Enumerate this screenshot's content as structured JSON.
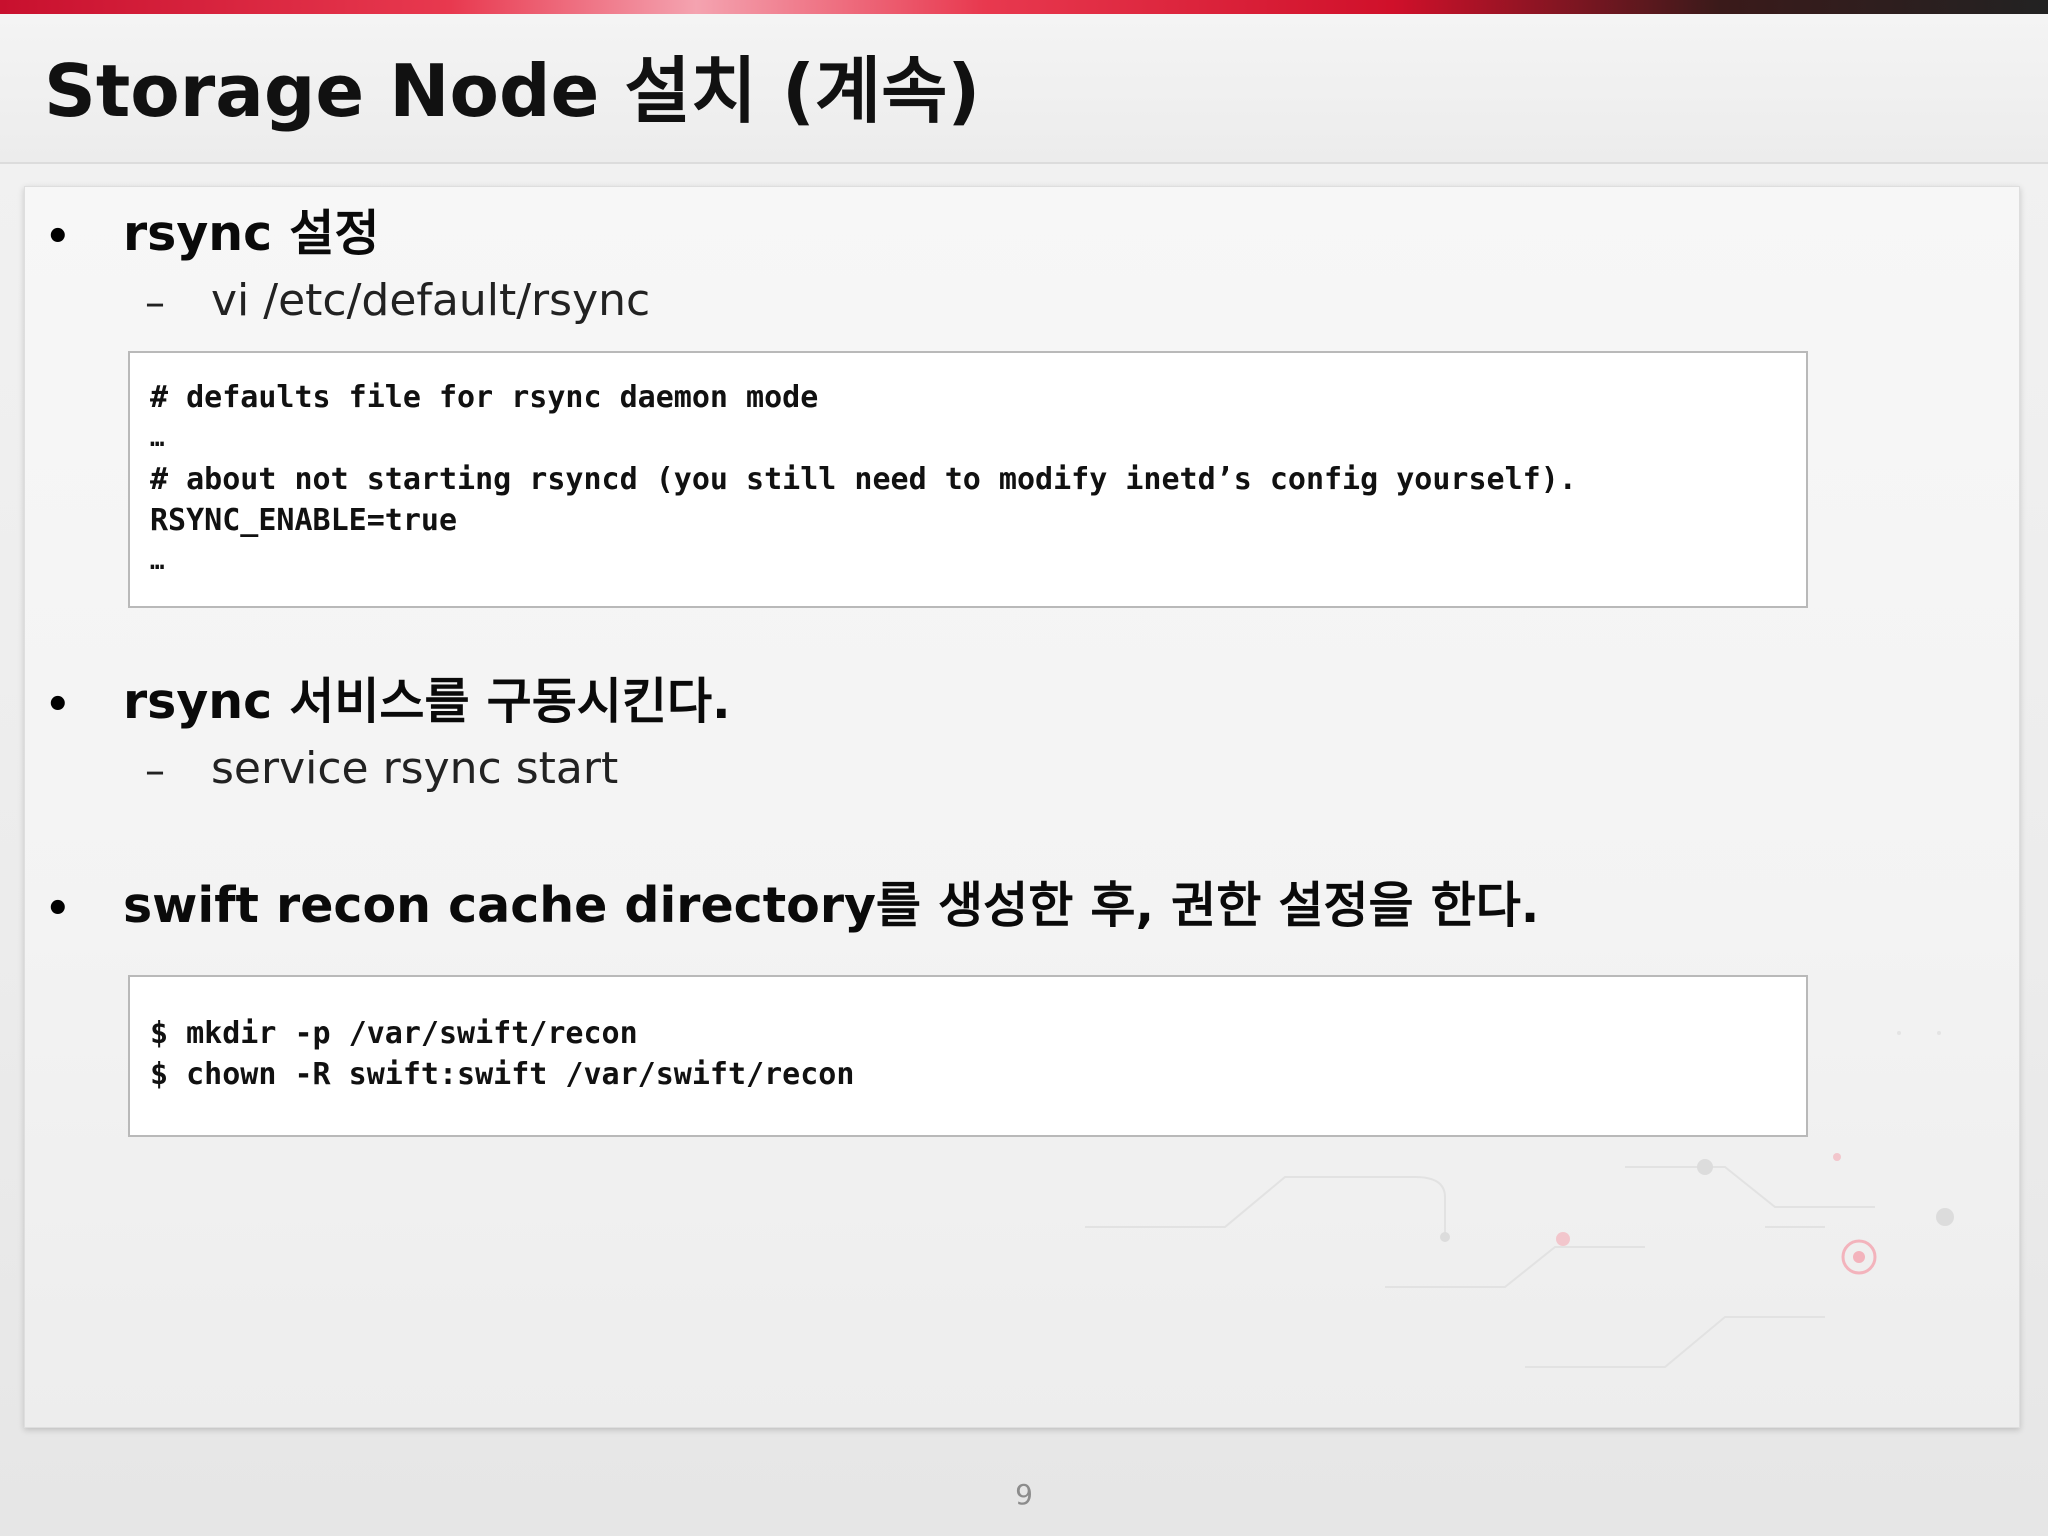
{
  "slide": {
    "title": "Storage Node 설치 (계속)",
    "page_number": "9"
  },
  "content": {
    "bullet_glyph": "•",
    "dash_glyph": "–",
    "bullets": [
      {
        "text": "rsync 설정",
        "sub": "vi /etc/default/rsync",
        "code": [
          "# defaults file for rsync daemon mode",
          "…",
          "# about not starting rsyncd (you still need to modify inetd’s config yourself).",
          "RSYNC_ENABLE=true",
          "…"
        ]
      },
      {
        "text": "rsync 서비스를 구동시킨다.",
        "sub": "service rsync start"
      },
      {
        "text": "swift recon cache directory를 생성한 후, 권한 설정을 한다.",
        "code": [
          "$ mkdir -p /var/swift/recon",
          "$ chown -R swift:swift /var/swift/recon"
        ]
      }
    ]
  },
  "colors": {
    "accent_red": "#c8102e",
    "accent_dark": "#222222",
    "code_border": "#b9b9b9"
  }
}
